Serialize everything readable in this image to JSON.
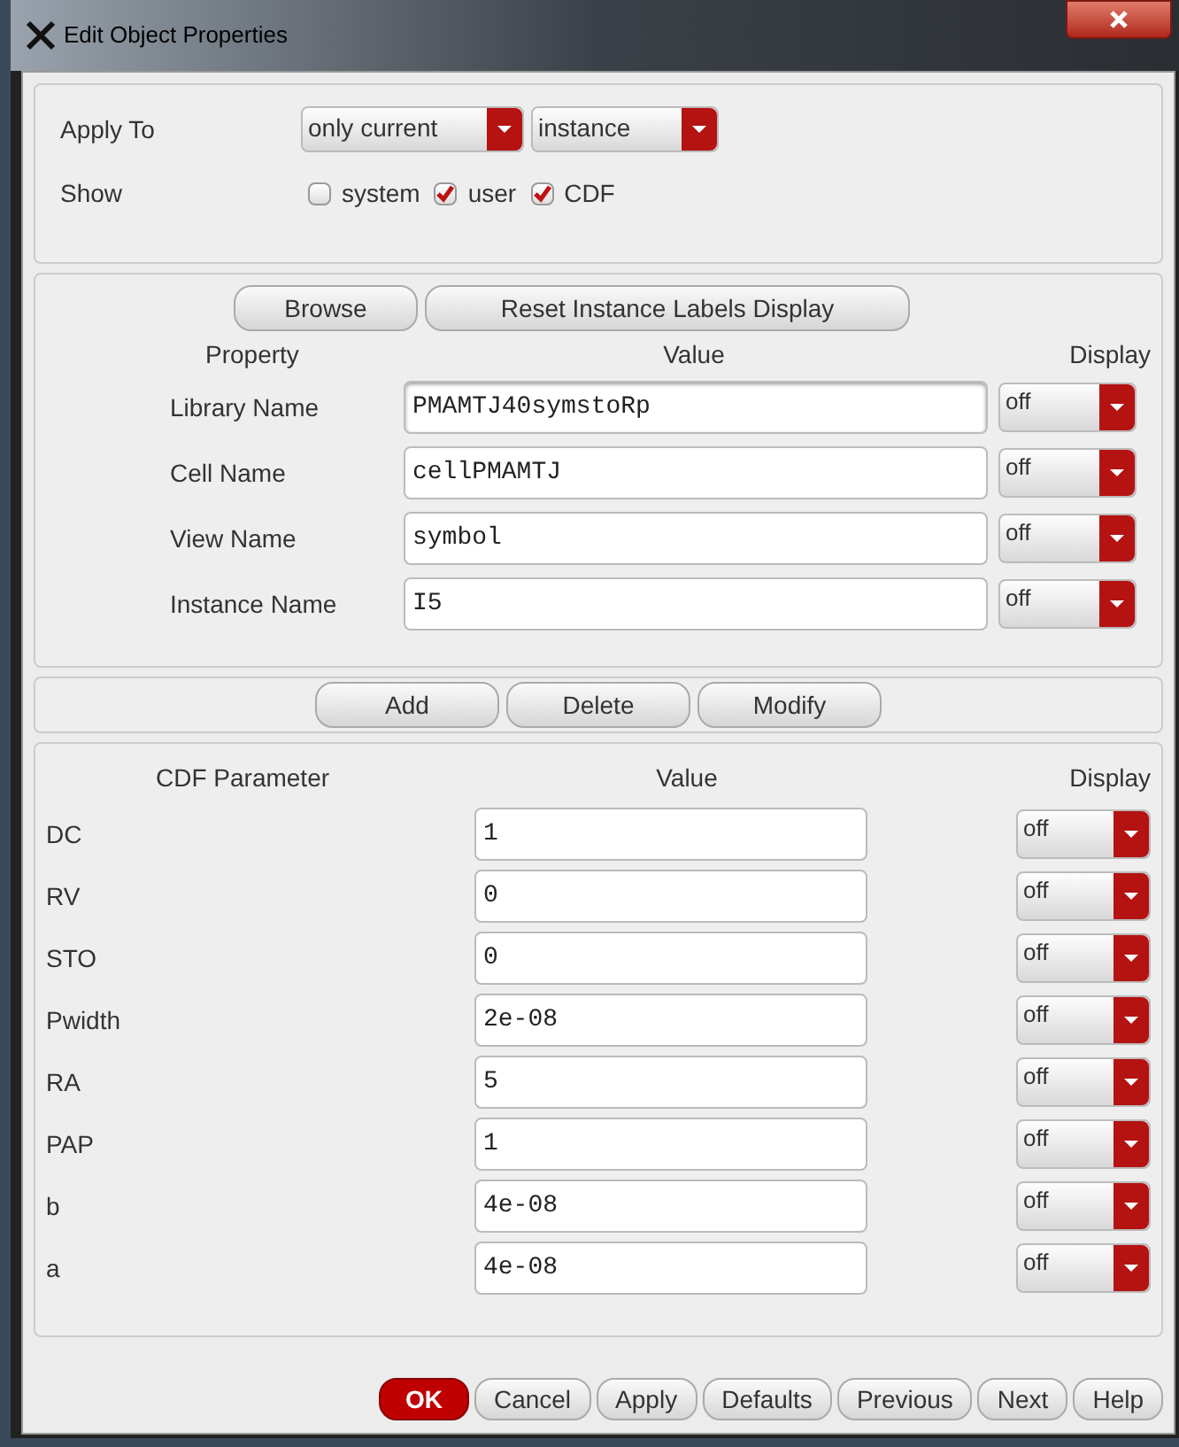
{
  "window": {
    "title": "Edit Object Properties"
  },
  "apply_to": {
    "label": "Apply To",
    "dropdowns": [
      "only current",
      "instance"
    ]
  },
  "show": {
    "label": "Show",
    "options": [
      {
        "label": "system",
        "checked": false
      },
      {
        "label": "user",
        "checked": true
      },
      {
        "label": "CDF",
        "checked": true
      }
    ]
  },
  "property_buttons": [
    "Browse",
    "Reset Instance Labels Display"
  ],
  "property_columns": [
    "Property",
    "Value",
    "Display"
  ],
  "properties": [
    {
      "name": "Library Name",
      "value": "PMAMTJ40symstoRp",
      "display": "off",
      "focused": true
    },
    {
      "name": "Cell Name",
      "value": "cellPMAMTJ",
      "display": "off",
      "focused": false
    },
    {
      "name": "View Name",
      "value": "symbol",
      "display": "off",
      "focused": false
    },
    {
      "name": "Instance Name",
      "value": "I5",
      "display": "off",
      "focused": false
    }
  ],
  "edit_buttons": [
    "Add",
    "Delete",
    "Modify"
  ],
  "cdf_columns": [
    "CDF Parameter",
    "Value",
    "Display"
  ],
  "cdf_parameters": [
    {
      "name": "DC",
      "value": "1",
      "display": "off"
    },
    {
      "name": "RV",
      "value": "0",
      "display": "off"
    },
    {
      "name": "STO",
      "value": "0",
      "display": "off"
    },
    {
      "name": "Pwidth",
      "value": "2e-08",
      "display": "off"
    },
    {
      "name": "RA",
      "value": "5",
      "display": "off"
    },
    {
      "name": "PAP",
      "value": "1",
      "display": "off"
    },
    {
      "name": "b",
      "value": "4e-08",
      "display": "off"
    },
    {
      "name": "a",
      "value": "4e-08",
      "display": "off"
    }
  ],
  "footer_buttons": [
    {
      "label": "OK",
      "kind": "primary"
    },
    {
      "label": "Cancel",
      "kind": "default"
    },
    {
      "label": "Apply",
      "kind": "default"
    },
    {
      "label": "Defaults",
      "kind": "default"
    },
    {
      "label": "Previous",
      "kind": "default"
    },
    {
      "label": "Next",
      "kind": "default"
    },
    {
      "label": "Help",
      "kind": "default"
    }
  ]
}
